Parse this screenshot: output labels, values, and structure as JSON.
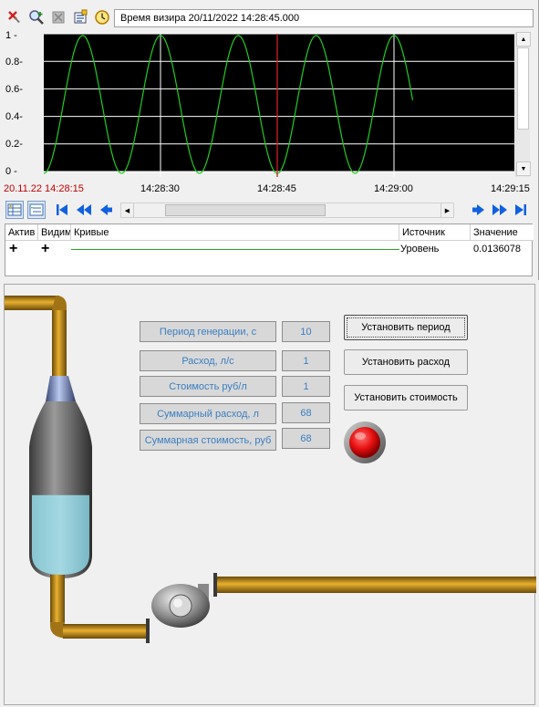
{
  "toolbar": {
    "icons": [
      "cursor-off-icon",
      "zoom-icon",
      "delete-icon",
      "properties-icon",
      "clock-icon"
    ],
    "vizir_text": "Время визира 20/11/2022 14:28:45.000"
  },
  "chart_data": {
    "type": "line",
    "series": [
      {
        "name": "Уровень",
        "color": "#22cc22"
      }
    ],
    "y_ticks": [
      "1 -",
      "0.8-",
      "0.6-",
      "0.4-",
      "0.2-",
      "0 -"
    ],
    "ylim": [
      0,
      1
    ],
    "x_start_label": "20.11.22 14:28:15",
    "x_ticks": [
      "14:28:30",
      "14:28:45",
      "14:29:00",
      "14:29:15"
    ],
    "x_range_seconds": [
      0,
      60
    ],
    "period_seconds": 10,
    "cursor_time": "14:28:45",
    "grid": true,
    "background": "#000000",
    "cursor_color": "#d02020",
    "date_label_color": "#c00000"
  },
  "curves_table": {
    "headers": [
      "Актив",
      "Видим",
      "Кривые",
      "Источник",
      "Значение"
    ],
    "rows": [
      {
        "active": "+",
        "visible": "+",
        "source": "Уровень",
        "value": "0.0136078"
      }
    ]
  },
  "parameters": [
    {
      "label": "Период генерации, с",
      "value": "10"
    },
    {
      "label": "Расход, л/с",
      "value": "1"
    },
    {
      "label": "Стоимость руб/л",
      "value": "1"
    },
    {
      "label": "Суммарный расход, л",
      "value": "68"
    },
    {
      "label": "Суммарная стоимость, руб",
      "value": "68"
    }
  ],
  "buttons": {
    "set_period": "Установить период",
    "set_flow": "Установить расход",
    "set_cost": "Установить стоимость"
  },
  "indicator": {
    "state": "alarm",
    "color": "#e81010"
  },
  "tank": {
    "level": 0.6
  }
}
